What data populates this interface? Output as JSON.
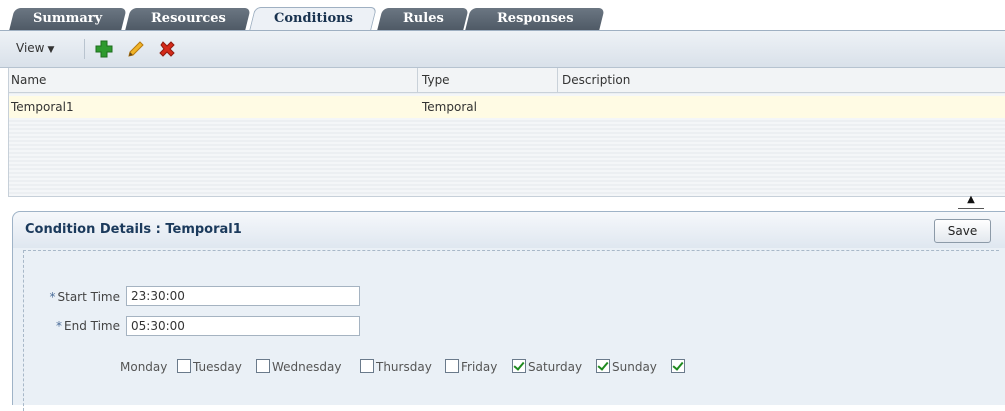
{
  "tabs": [
    {
      "label": "Summary",
      "active": false
    },
    {
      "label": "Resources",
      "active": false
    },
    {
      "label": "Conditions",
      "active": true
    },
    {
      "label": "Rules",
      "active": false
    },
    {
      "label": "Responses",
      "active": false
    }
  ],
  "toolbar": {
    "view_label": "View",
    "icons": [
      "add-icon",
      "edit-icon",
      "delete-icon"
    ]
  },
  "table": {
    "columns": [
      "Name",
      "Type",
      "Description"
    ],
    "rows": [
      {
        "name": "Temporal1",
        "type": "Temporal",
        "description": ""
      }
    ]
  },
  "details": {
    "title": "Condition Details : Temporal1",
    "save_label": "Save",
    "required_marker": "*",
    "start_time_label": "Start Time",
    "start_time_value": "23:30:00",
    "end_time_label": "End Time",
    "end_time_value": "05:30:00",
    "days": [
      {
        "label": "Monday",
        "checked": false
      },
      {
        "label": "Tuesday",
        "checked": false
      },
      {
        "label": "Wednesday",
        "checked": false
      },
      {
        "label": "Thursday",
        "checked": false
      },
      {
        "label": "Friday",
        "checked": true
      },
      {
        "label": "Saturday",
        "checked": true
      },
      {
        "label": "Sunday",
        "checked": true
      }
    ]
  },
  "colors": {
    "tab_inactive": "#5b6672",
    "tab_active": "#edf1f6",
    "selected_row": "#fffbe4",
    "panel_title": "#1b3a5c",
    "check": "#1f8a1f",
    "add_icon": "#2e9a2e",
    "edit_icon": "#e0a21a",
    "delete_icon": "#d42a1a"
  }
}
